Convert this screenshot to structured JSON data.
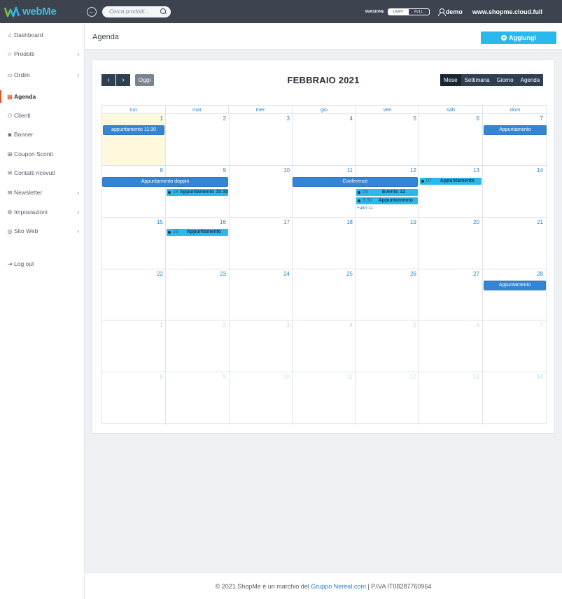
{
  "app": {
    "logo_text": "webMe"
  },
  "topbar": {
    "search_placeholder": "Cerca prodotti...",
    "version_label": "VERSIONE",
    "version_light": "LIGHT",
    "version_full": "FULL",
    "user": "demo",
    "site": "www.shopme.cloud.full"
  },
  "sidebar": {
    "items": [
      {
        "label": "Dashboard",
        "icon": "home-icon"
      },
      {
        "label": "Prodotti",
        "icon": "star-icon",
        "chevron": true
      },
      {
        "label": "Ordini",
        "icon": "box-icon",
        "chevron": true
      },
      {
        "label": "Agenda",
        "icon": "calendar-icon",
        "active": true
      },
      {
        "label": "Clienti",
        "icon": "people-icon"
      },
      {
        "label": "Banner",
        "icon": "banner-icon"
      },
      {
        "label": "Coupon Sconti",
        "icon": "coupon-icon"
      },
      {
        "label": "Contatti ricevuti",
        "icon": "mail-icon"
      },
      {
        "label": "Newsletter",
        "icon": "newsletter-icon",
        "chevron": true
      },
      {
        "label": "Impostazioni",
        "icon": "gear-icon",
        "chevron": true
      },
      {
        "label": "Sito Web",
        "icon": "globe-icon",
        "chevron": true
      }
    ],
    "logout": "Log out"
  },
  "header": {
    "title": "Agenda",
    "add_label": "Aggiungi"
  },
  "calendar": {
    "today_label": "Oggi",
    "month_title": "FEBBRAIO 2021",
    "views": [
      "Mese",
      "Settimana",
      "Giorno",
      "Agenda"
    ],
    "active_view": "Mese",
    "weekdays": [
      "lun",
      "mar",
      "mer",
      "gio",
      "ven",
      "sab",
      "dom"
    ],
    "weeks": [
      [
        "1",
        "2",
        "3",
        "4",
        "5",
        "6",
        "7"
      ],
      [
        "8",
        "9",
        "10",
        "11",
        "12",
        "13",
        "14"
      ],
      [
        "15",
        "16",
        "17",
        "18",
        "19",
        "20",
        "21"
      ],
      [
        "22",
        "23",
        "24",
        "25",
        "26",
        "27",
        "28"
      ],
      [
        "1",
        "2",
        "3",
        "4",
        "5",
        "6",
        "7"
      ],
      [
        "8",
        "9",
        "10",
        "11",
        "12",
        "13",
        "14"
      ]
    ],
    "events": {
      "e1": "appuntamento 11:30",
      "e2": "Appuntamento",
      "e3": "Appuntamento doppio",
      "e4": "Conference",
      "e5_time": "18",
      "e5": "Appuntamento 15:30",
      "e6_time": "05",
      "e6": "Evento 12",
      "e7_time": "9:30",
      "e7": "Appuntamento",
      "e8_time": "07",
      "e8": "Appuntamento",
      "more": "+altri 11",
      "e9_time": "16",
      "e9": "Appuntamento",
      "e10": "Appuntamento"
    }
  },
  "footer": {
    "prefix": "© 2021 ShopMe è un marchio del ",
    "link": "Gruppo Nereal.com",
    "suffix": " | P.IVA IT08287760964"
  }
}
